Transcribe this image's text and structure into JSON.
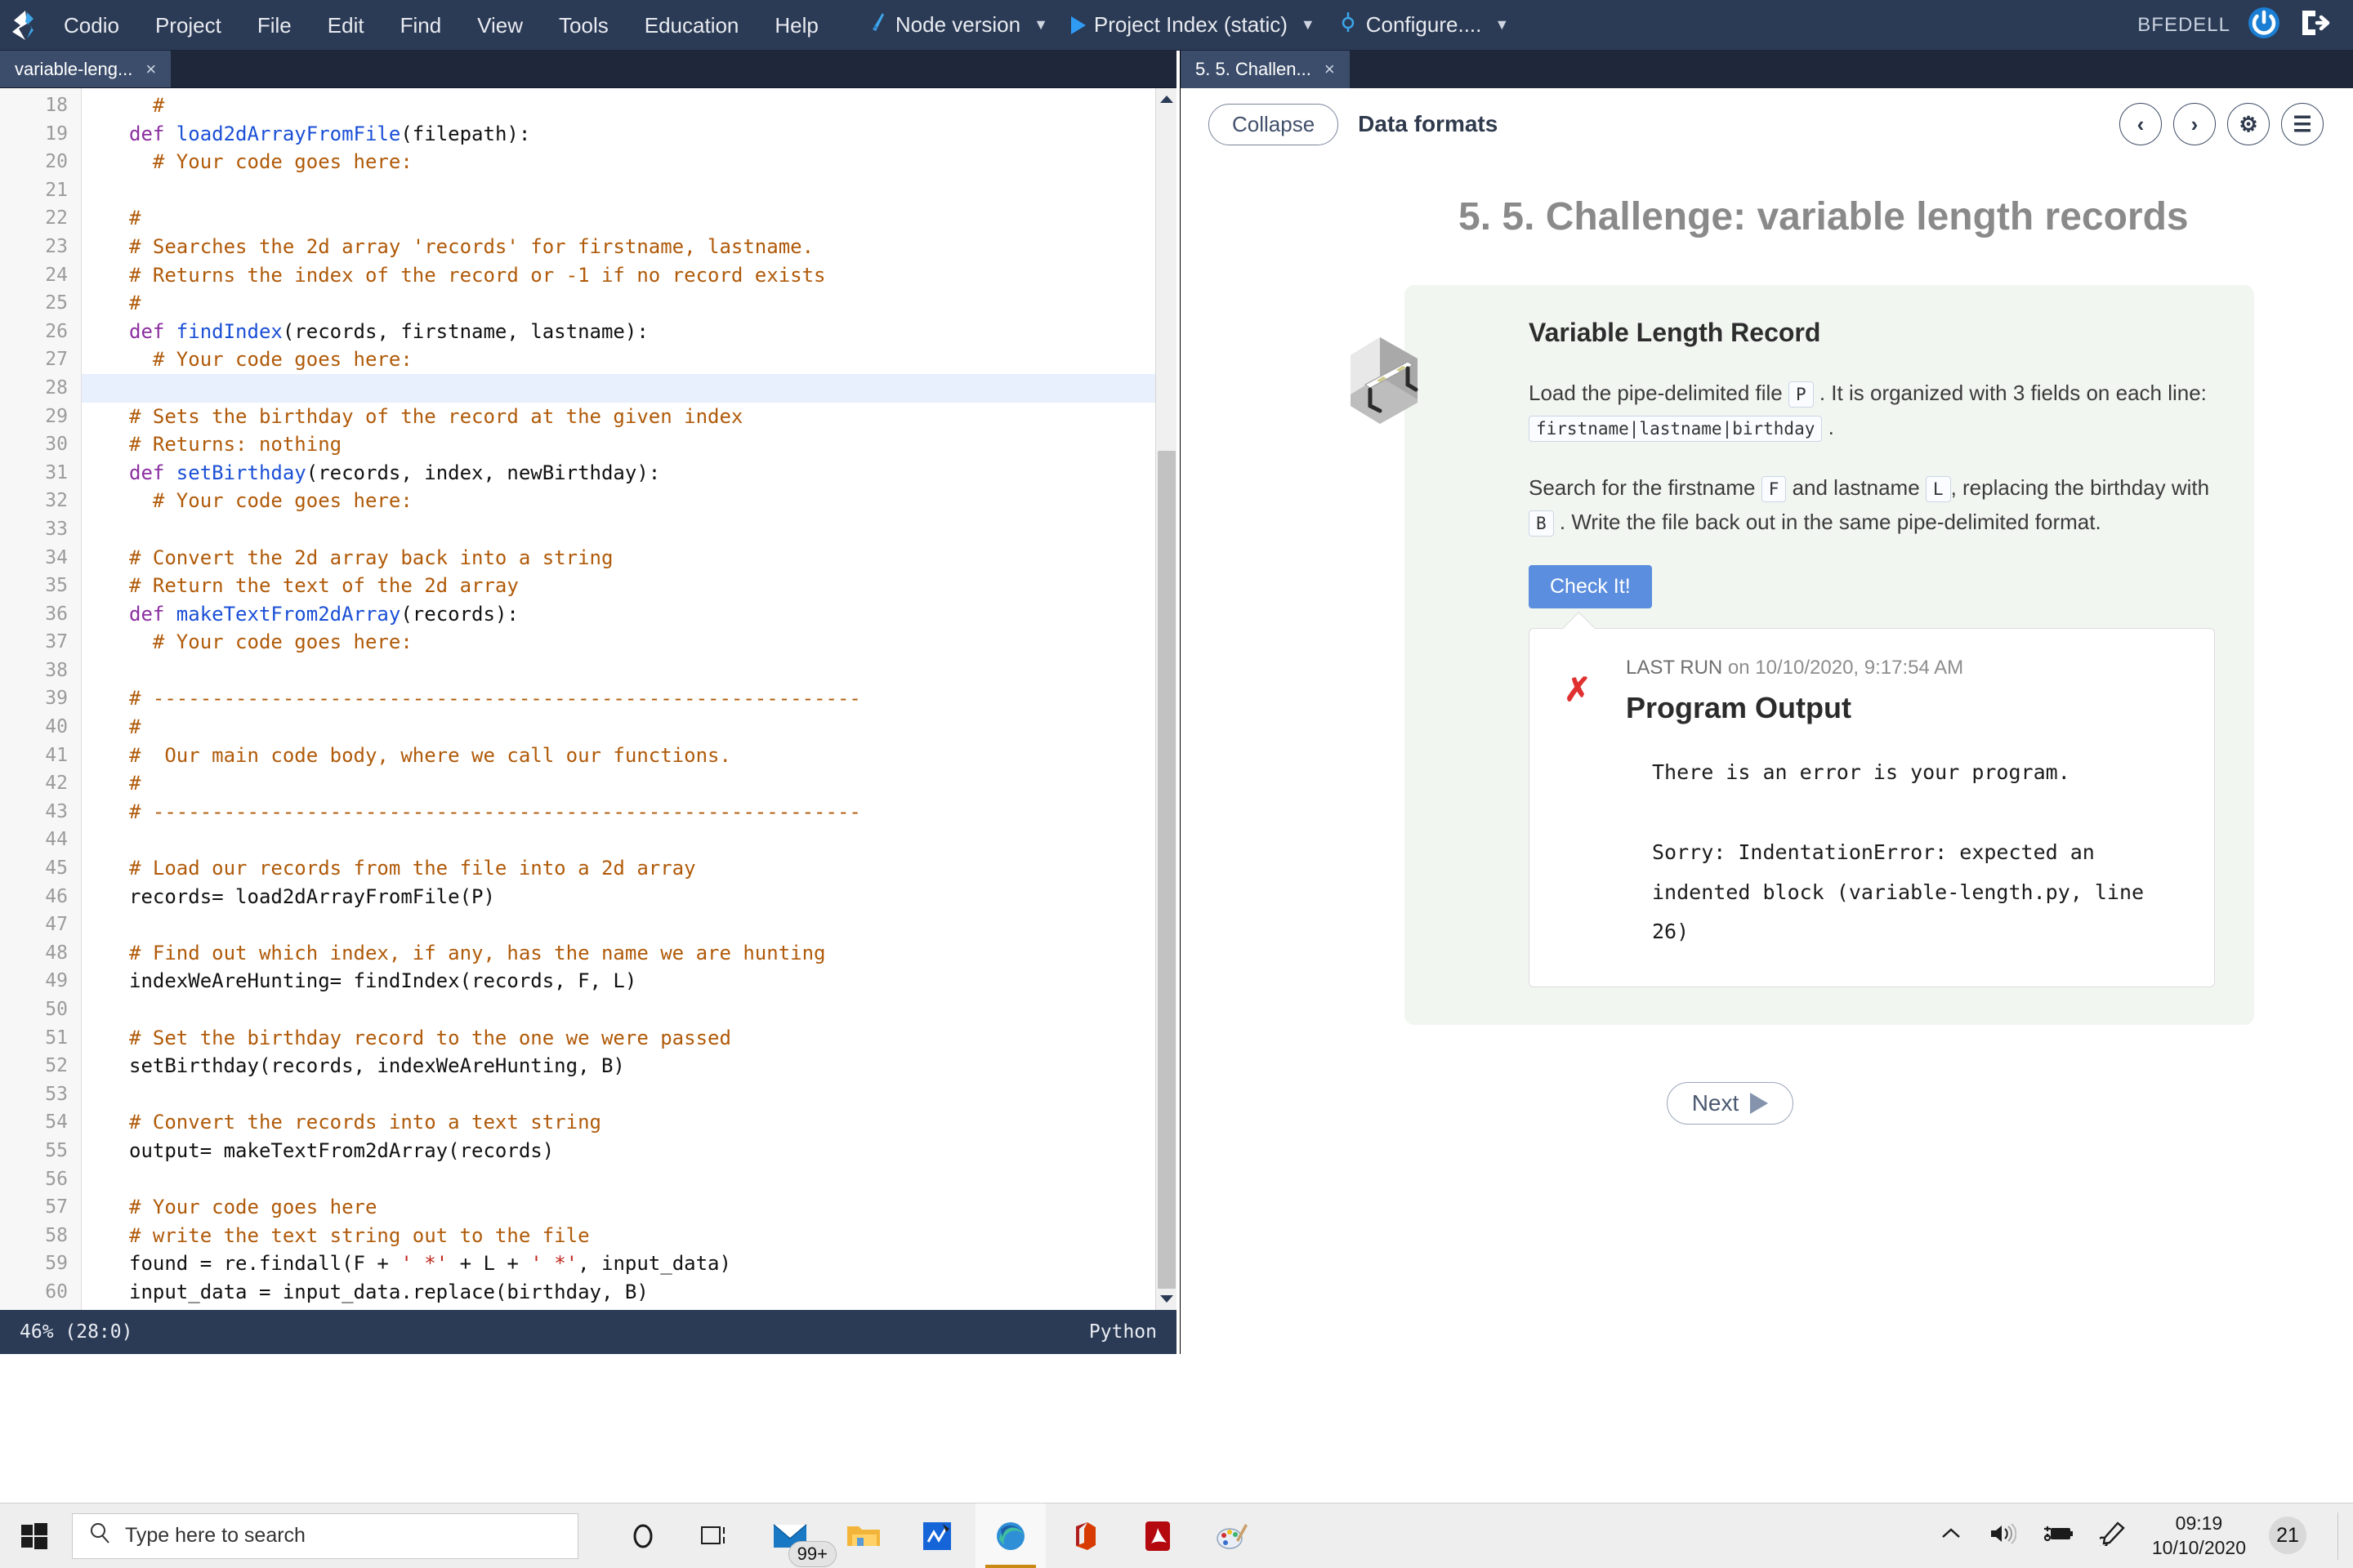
{
  "menubar": {
    "logo_icon": "codio-logo-icon",
    "items": [
      "Codio",
      "Project",
      "File",
      "Edit",
      "Find",
      "View",
      "Tools",
      "Education",
      "Help"
    ],
    "run_buttons": [
      {
        "label": "Node version",
        "icon": "node-icon",
        "caret": "▼"
      },
      {
        "label": "Project Index (static)",
        "icon": "play-icon",
        "caret": "▼"
      },
      {
        "label": "Configure....",
        "icon": "target-icon",
        "caret": "▼"
      }
    ],
    "user": "BFEDELL",
    "power_icon": "power-icon",
    "logout_icon": "logout-icon"
  },
  "editor": {
    "tab": {
      "label": "variable-leng...",
      "close": "×"
    },
    "first_line_number": 18,
    "active_line": 28,
    "lines": [
      {
        "n": 18,
        "segments": [
          {
            "t": "  #",
            "c": "cm"
          }
        ]
      },
      {
        "n": 19,
        "segments": [
          {
            "t": "def ",
            "c": "kw"
          },
          {
            "t": "load2dArrayFromFile",
            "c": "fn"
          },
          {
            "t": "(filepath):",
            "c": "pl"
          }
        ]
      },
      {
        "n": 20,
        "segments": [
          {
            "t": "  # Your code goes here:",
            "c": "cm"
          }
        ]
      },
      {
        "n": 21,
        "segments": []
      },
      {
        "n": 22,
        "segments": [
          {
            "t": "#",
            "c": "cm"
          }
        ]
      },
      {
        "n": 23,
        "segments": [
          {
            "t": "# Searches the 2d array 'records' for firstname, lastname.",
            "c": "cm"
          }
        ]
      },
      {
        "n": 24,
        "segments": [
          {
            "t": "# Returns the index of the record or -1 if no record exists",
            "c": "cm"
          }
        ]
      },
      {
        "n": 25,
        "segments": [
          {
            "t": "#",
            "c": "cm"
          }
        ]
      },
      {
        "n": 26,
        "segments": [
          {
            "t": "def ",
            "c": "kw"
          },
          {
            "t": "findIndex",
            "c": "fn"
          },
          {
            "t": "(records, firstname, lastname):",
            "c": "pl"
          }
        ]
      },
      {
        "n": 27,
        "segments": [
          {
            "t": "  # Your code goes here:",
            "c": "cm"
          }
        ]
      },
      {
        "n": 28,
        "segments": []
      },
      {
        "n": 29,
        "segments": [
          {
            "t": "# Sets the birthday of the record at the given index",
            "c": "cm"
          }
        ]
      },
      {
        "n": 30,
        "segments": [
          {
            "t": "# Returns: nothing",
            "c": "cm"
          }
        ]
      },
      {
        "n": 31,
        "segments": [
          {
            "t": "def ",
            "c": "kw"
          },
          {
            "t": "setBirthday",
            "c": "fn"
          },
          {
            "t": "(records, index, newBirthday):",
            "c": "pl"
          }
        ]
      },
      {
        "n": 32,
        "segments": [
          {
            "t": "  # Your code goes here:",
            "c": "cm"
          }
        ]
      },
      {
        "n": 33,
        "segments": []
      },
      {
        "n": 34,
        "segments": [
          {
            "t": "# Convert the 2d array back into a string",
            "c": "cm"
          }
        ]
      },
      {
        "n": 35,
        "segments": [
          {
            "t": "# Return the text of the 2d array",
            "c": "cm"
          }
        ]
      },
      {
        "n": 36,
        "segments": [
          {
            "t": "def ",
            "c": "kw"
          },
          {
            "t": "makeTextFrom2dArray",
            "c": "fn"
          },
          {
            "t": "(records):",
            "c": "pl"
          }
        ]
      },
      {
        "n": 37,
        "segments": [
          {
            "t": "  # Your code goes here:",
            "c": "cm"
          }
        ]
      },
      {
        "n": 38,
        "segments": []
      },
      {
        "n": 39,
        "segments": [
          {
            "t": "# ------------------------------------------------------------",
            "c": "cm"
          }
        ]
      },
      {
        "n": 40,
        "segments": [
          {
            "t": "#",
            "c": "cm"
          }
        ]
      },
      {
        "n": 41,
        "segments": [
          {
            "t": "#  Our main code body, where we call our functions.",
            "c": "cm"
          }
        ]
      },
      {
        "n": 42,
        "segments": [
          {
            "t": "#",
            "c": "cm"
          }
        ]
      },
      {
        "n": 43,
        "segments": [
          {
            "t": "# ------------------------------------------------------------",
            "c": "cm"
          }
        ]
      },
      {
        "n": 44,
        "segments": []
      },
      {
        "n": 45,
        "segments": [
          {
            "t": "# Load our records from the file into a 2d array",
            "c": "cm"
          }
        ]
      },
      {
        "n": 46,
        "segments": [
          {
            "t": "records= load2dArrayFromFile(P)",
            "c": "pl"
          }
        ]
      },
      {
        "n": 47,
        "segments": []
      },
      {
        "n": 48,
        "segments": [
          {
            "t": "# Find out which index, if any, has the name we are hunting",
            "c": "cm"
          }
        ]
      },
      {
        "n": 49,
        "segments": [
          {
            "t": "indexWeAreHunting= findIndex(records, F, L)",
            "c": "pl"
          }
        ]
      },
      {
        "n": 50,
        "segments": []
      },
      {
        "n": 51,
        "segments": [
          {
            "t": "# Set the birthday record to the one we were passed",
            "c": "cm"
          }
        ]
      },
      {
        "n": 52,
        "segments": [
          {
            "t": "setBirthday(records, indexWeAreHunting, B)",
            "c": "pl"
          }
        ]
      },
      {
        "n": 53,
        "segments": []
      },
      {
        "n": 54,
        "segments": [
          {
            "t": "# Convert the records into a text string",
            "c": "cm"
          }
        ]
      },
      {
        "n": 55,
        "segments": [
          {
            "t": "output= makeTextFrom2dArray(records)",
            "c": "pl"
          }
        ]
      },
      {
        "n": 56,
        "segments": []
      },
      {
        "n": 57,
        "segments": [
          {
            "t": "# Your code goes here",
            "c": "cm"
          }
        ]
      },
      {
        "n": 58,
        "segments": [
          {
            "t": "# write the text string out to the file",
            "c": "cm"
          }
        ]
      },
      {
        "n": 59,
        "segments": [
          {
            "t": "found = re.findall(F + ",
            "c": "pl"
          },
          {
            "t": "' *'",
            "c": "st"
          },
          {
            "t": " + L + ",
            "c": "pl"
          },
          {
            "t": "' *'",
            "c": "st"
          },
          {
            "t": ", input_data)",
            "c": "pl"
          }
        ]
      },
      {
        "n": 60,
        "segments": [
          {
            "t": "input_data = input_data.replace(birthday, B)",
            "c": "pl"
          }
        ]
      }
    ],
    "status": {
      "left": "46%  (28:0)",
      "right": "Python"
    }
  },
  "guide": {
    "tab": {
      "label": "5. 5. Challen...",
      "close": "×"
    },
    "collapse_label": "Collapse",
    "section_title": "Data formats",
    "header_icons": [
      "prev-icon",
      "next-icon",
      "gear-icon",
      "toc-icon"
    ],
    "prev_glyph": "‹",
    "next_glyph": "›",
    "gear_glyph": "⚙",
    "toc_glyph": "☰",
    "page_title": "5. 5. Challenge: variable length records",
    "card": {
      "icon": "hurdle-room-icon",
      "heading": "Variable Length Record",
      "para1_a": "Load the pipe-delimited file ",
      "para1_code1": "P",
      "para1_b": " . It is organized with 3 fields on each line: ",
      "para1_code2": "firstname|lastname|birthday",
      "para1_c": " .",
      "para2_a": "Search for the firstname ",
      "para2_code1": "F",
      "para2_b": " and lastname ",
      "para2_code2": "L",
      "para2_c": ", replacing the birthday with ",
      "para2_code3": "B",
      "para2_d": " . Write the file back out in the same pipe-delimited format.",
      "check_button": "Check It!",
      "status_icon": "error-x-icon",
      "last_run_label": "LAST RUN",
      "last_run_value": " on 10/10/2020, 9:17:54 AM",
      "output_heading": "Program Output",
      "output_text": "There is an error is your program.\n\nSorry: IndentationError: expected an\nindented block (variable-length.py, line\n26)"
    },
    "next_button": "Next"
  },
  "taskbar": {
    "start_icon": "windows-start-icon",
    "search_icon": "search-icon",
    "search_placeholder": "Type here to search",
    "icons": [
      {
        "name": "cortana-icon",
        "badge": ""
      },
      {
        "name": "task-view-icon",
        "badge": ""
      },
      {
        "name": "mail-icon",
        "badge": "99+"
      },
      {
        "name": "file-explorer-icon",
        "badge": ""
      },
      {
        "name": "onenote-icon",
        "badge": ""
      },
      {
        "name": "microsoft-edge-icon",
        "badge": ""
      },
      {
        "name": "office-icon",
        "badge": ""
      },
      {
        "name": "adobe-acrobat-icon",
        "badge": ""
      },
      {
        "name": "paint-icon",
        "badge": ""
      }
    ],
    "tray": {
      "chevron_icon": "show-hidden-icons-icon",
      "volume_icon": "volume-icon",
      "battery_icon": "battery-charging-icon",
      "pen_icon": "pen-icon",
      "time": "09:19",
      "date": "10/10/2020",
      "notifications_icon": "action-center-icon",
      "notifications_count": "21"
    }
  },
  "colors": {
    "menubar_bg": "#2b3a55",
    "tab_active": "#3c4d6b",
    "accent_blue": "#5b8ede",
    "comment": "#b05a09",
    "keyword": "#8b2fa0",
    "function": "#1a4fd6",
    "string": "#c2281e",
    "card_bg": "#f1f6f1",
    "error_red": "#e03131"
  }
}
